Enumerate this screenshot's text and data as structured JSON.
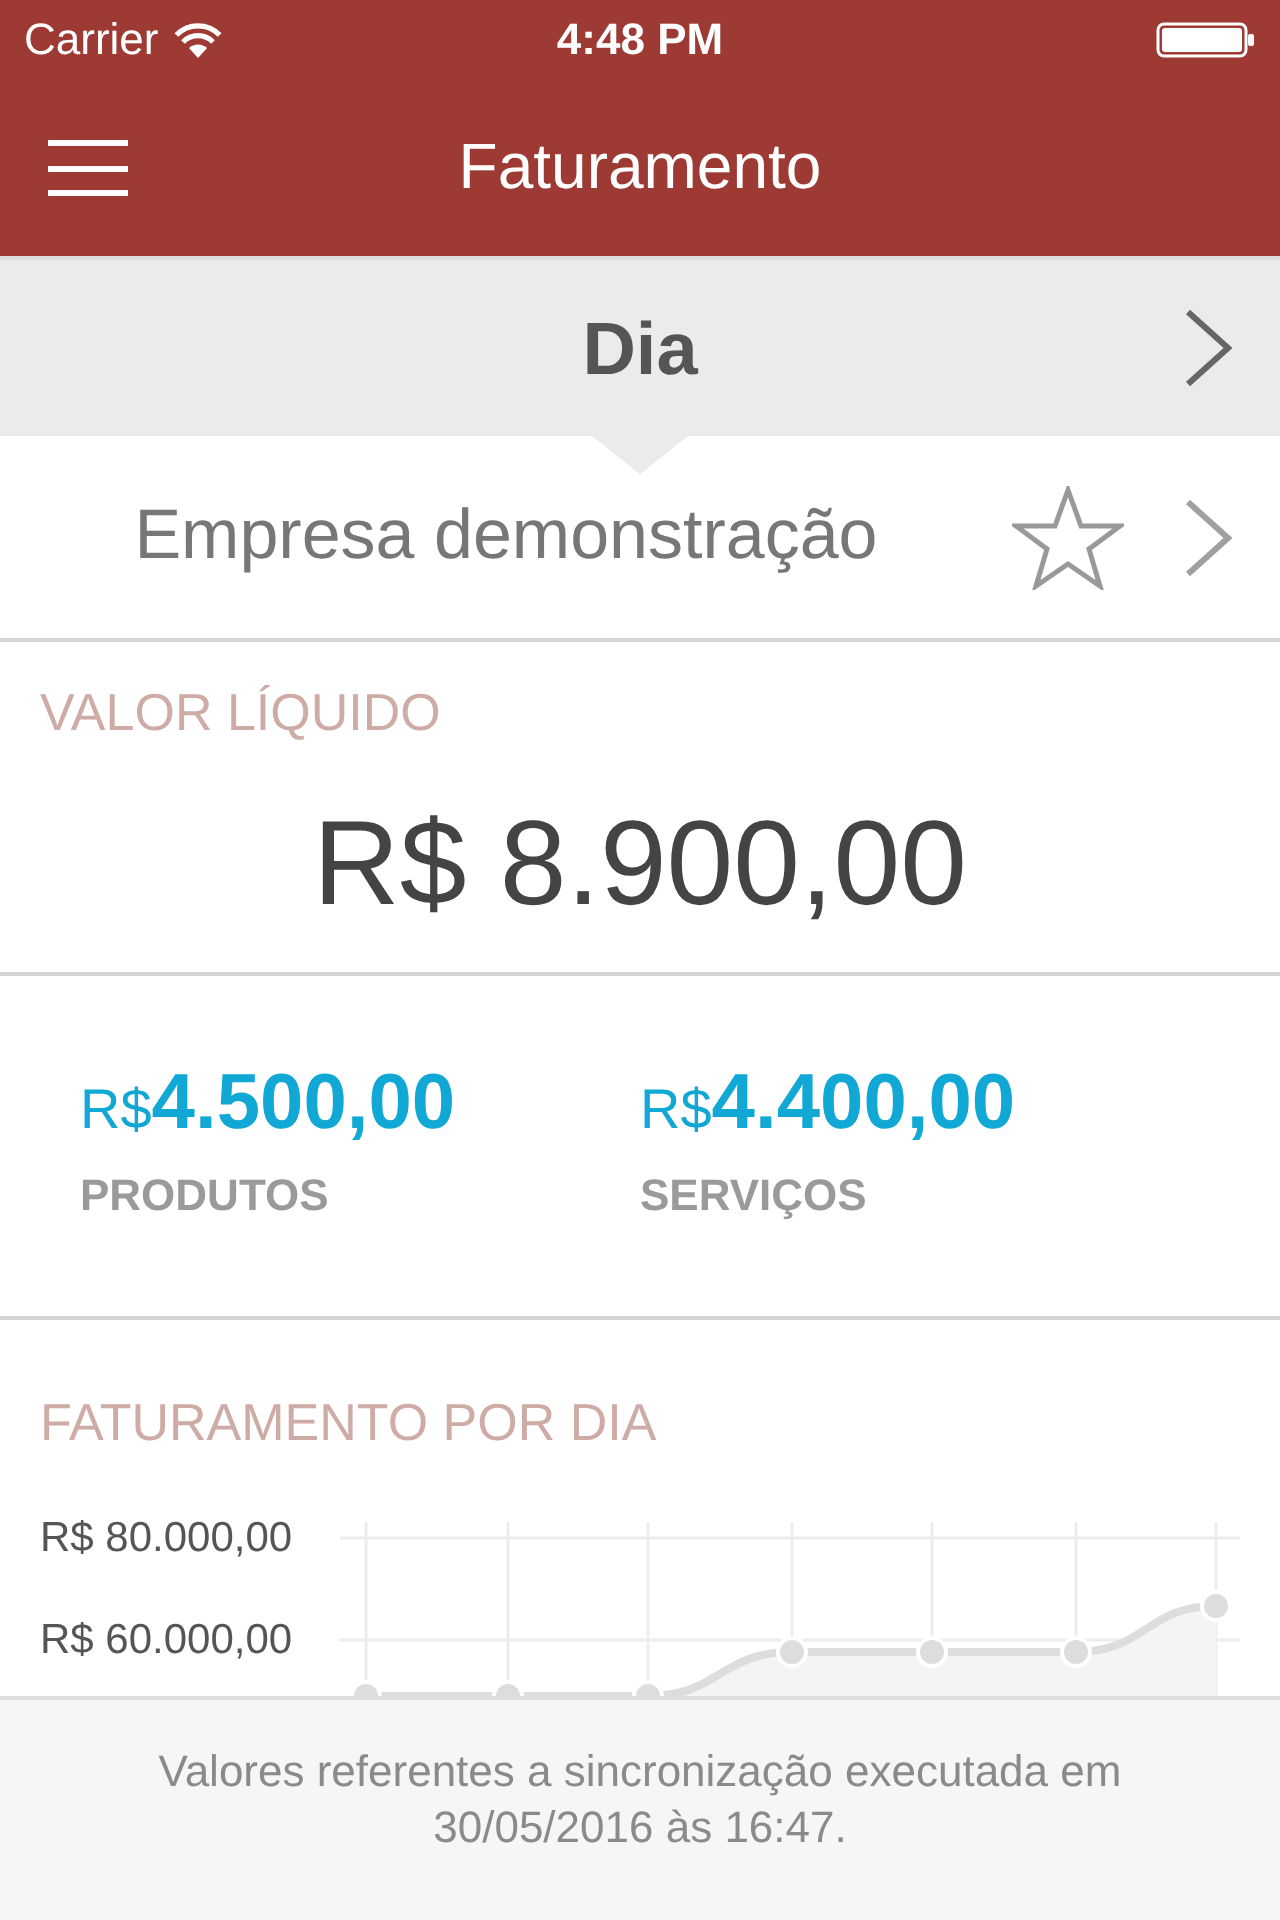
{
  "status_bar": {
    "carrier": "Carrier",
    "time": "4:48 PM"
  },
  "nav_bar": {
    "title": "Faturamento"
  },
  "period_selector": {
    "label": "Dia"
  },
  "company": {
    "name": "Empresa demonstração",
    "favorite": false
  },
  "net_value": {
    "label": "VALOR LÍQUIDO",
    "value": "R$ 8.900,00"
  },
  "breakdown": [
    {
      "currency": "R$",
      "amount": "4.500,00",
      "label": "PRODUTOS"
    },
    {
      "currency": "R$",
      "amount": "4.400,00",
      "label": "SERVIÇOS"
    }
  ],
  "chart_section": {
    "title": "FATURAMENTO POR DIA",
    "y_axis_labels": [
      "R$ 80.000,00",
      "R$ 60.000,00"
    ]
  },
  "footer": {
    "text": "Valores referentes a sincronização executada em 30/05/2016 às 16:47."
  }
}
